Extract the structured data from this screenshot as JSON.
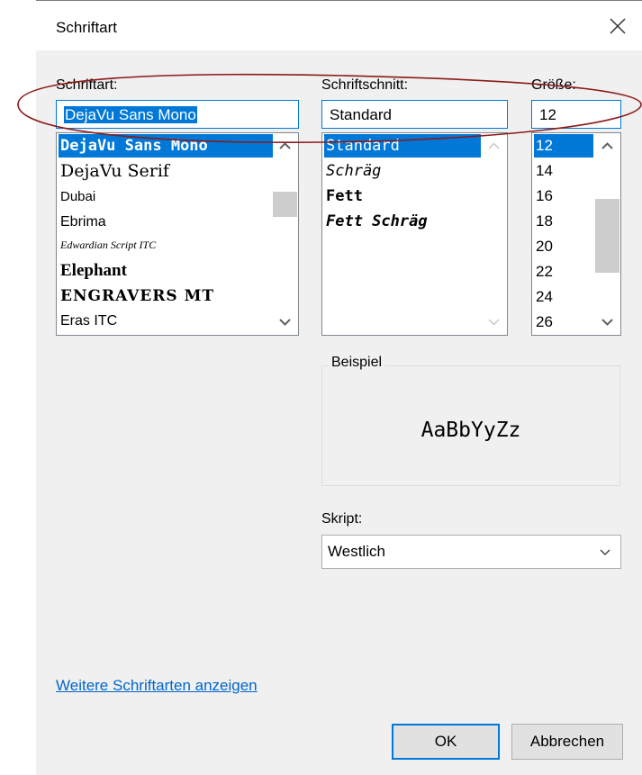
{
  "dialog": {
    "title": "Schriftart"
  },
  "font": {
    "label": "Schriftart:",
    "value": "DejaVu Sans Mono",
    "items": [
      {
        "label": "DejaVu Sans Mono",
        "selected": true
      },
      {
        "label": "DejaVu Serif"
      },
      {
        "label": "Dubai"
      },
      {
        "label": "Ebrima"
      },
      {
        "label": "Edwardian Script ITC"
      },
      {
        "label": "Elephant"
      },
      {
        "label": "ENGRAVERS MT"
      },
      {
        "label": "Eras ITC"
      }
    ]
  },
  "style": {
    "label": "Schriftschnitt:",
    "value": "Standard",
    "items": [
      {
        "label": "Standard",
        "selected": true
      },
      {
        "label": "Schräg"
      },
      {
        "label": "Fett"
      },
      {
        "label": "Fett Schräg"
      }
    ]
  },
  "size": {
    "label": "Größe:",
    "value": "12",
    "items": [
      {
        "label": "12",
        "selected": true
      },
      {
        "label": "14"
      },
      {
        "label": "16"
      },
      {
        "label": "18"
      },
      {
        "label": "20"
      },
      {
        "label": "22"
      },
      {
        "label": "24"
      },
      {
        "label": "26"
      }
    ]
  },
  "sample": {
    "label": "Beispiel",
    "text": "AaBbYyZz"
  },
  "script": {
    "label": "Skript:",
    "value": "Westlich"
  },
  "more_fonts_link": "Weitere Schriftarten anzeigen",
  "buttons": {
    "ok": "OK",
    "cancel": "Abbrechen"
  },
  "colors": {
    "selection": "#0078d7",
    "annotation": "#8b1a1a",
    "link": "#0066cc"
  },
  "icons": {
    "close": "close-icon",
    "scroll_up": "chevron-up-icon",
    "scroll_down": "chevron-down-icon",
    "dropdown": "chevron-down-icon"
  }
}
